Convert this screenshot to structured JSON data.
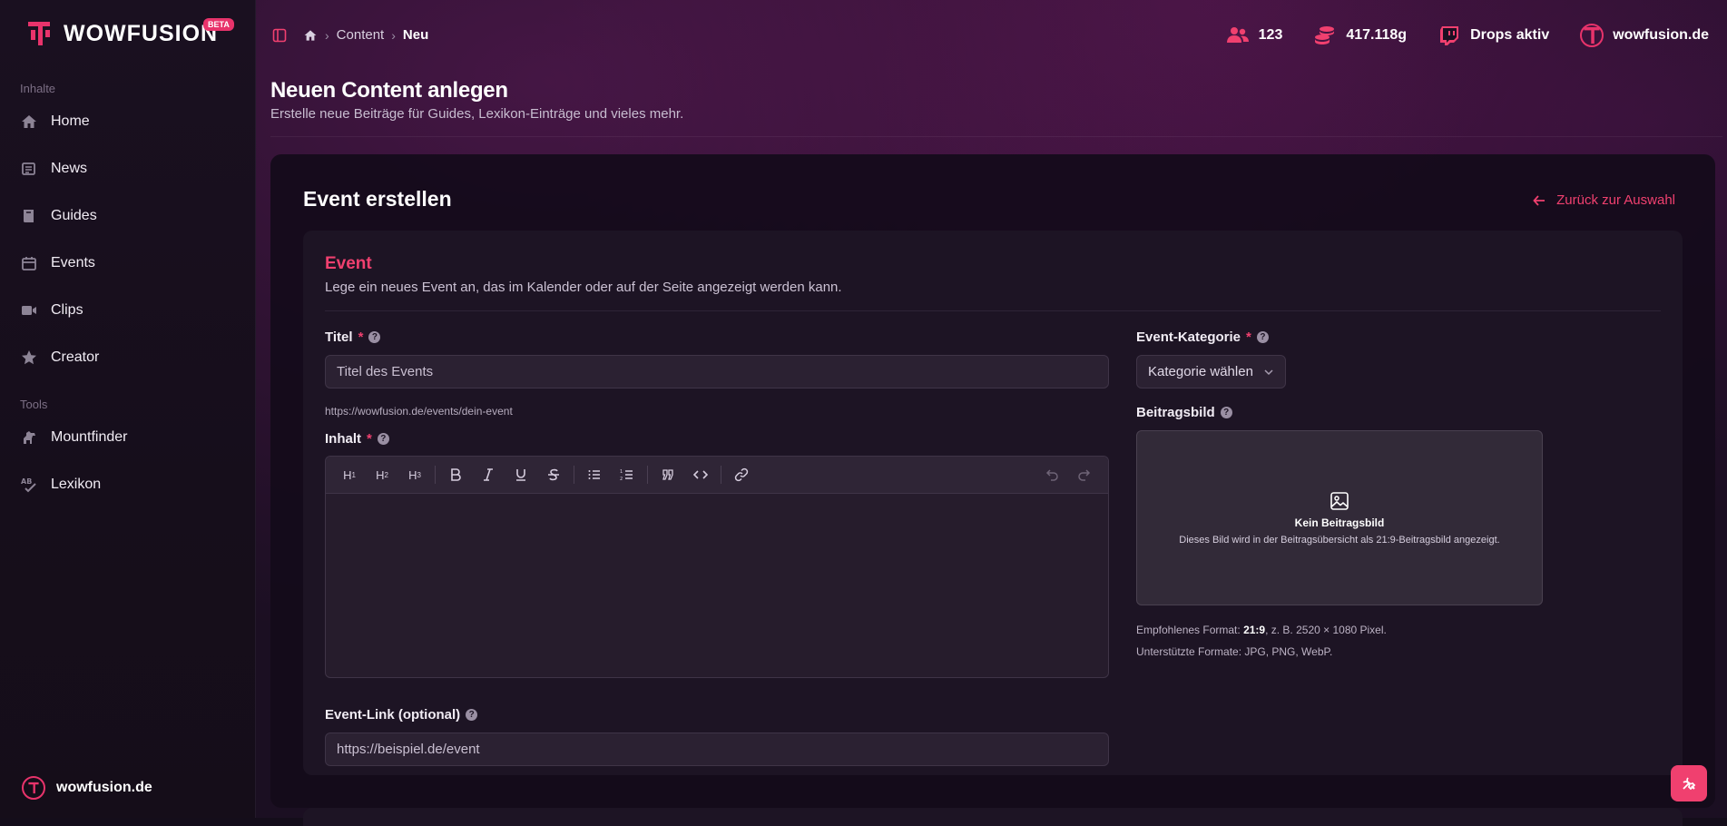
{
  "brand": {
    "name": "WOWFUSION",
    "badge": "BETA",
    "accent": "#e8336b"
  },
  "sidebar": {
    "sections": [
      {
        "label": "Inhalte",
        "items": [
          {
            "label": "Home",
            "icon": "home-icon"
          },
          {
            "label": "News",
            "icon": "newspaper-icon"
          },
          {
            "label": "Guides",
            "icon": "book-icon"
          },
          {
            "label": "Events",
            "icon": "calendar-icon"
          },
          {
            "label": "Clips",
            "icon": "video-icon"
          },
          {
            "label": "Creator",
            "icon": "star-icon"
          }
        ]
      },
      {
        "label": "Tools",
        "items": [
          {
            "label": "Mountfinder",
            "icon": "horse-icon"
          },
          {
            "label": "Lexikon",
            "icon": "abc-check-icon"
          }
        ]
      }
    ],
    "footer": {
      "label": "wowfusion.de"
    }
  },
  "topbar": {
    "breadcrumb": [
      "Content",
      "Neu"
    ],
    "stats": {
      "users": "123",
      "gold": "417.118g",
      "drops": "Drops aktiv",
      "site": "wowfusion.de"
    }
  },
  "header": {
    "title": "Neuen Content anlegen",
    "subtitle": "Erstelle neue Beiträge für Guides, Lexikon-Einträge und vieles mehr."
  },
  "panel": {
    "title": "Event erstellen",
    "back_label": "Zurück zur Auswahl"
  },
  "form": {
    "title": "Event",
    "description": "Lege ein neues Event an, das im Kalender oder auf der Seite angezeigt werden kann.",
    "title_field": {
      "label": "Titel",
      "placeholder": "Titel des Events",
      "slug": "https://wowfusion.de/events/dein-event"
    },
    "content_field": {
      "label": "Inhalt",
      "toolbar": [
        "H1",
        "H2",
        "H3",
        "bold",
        "italic",
        "underline",
        "strikethrough",
        "bullet-list",
        "ordered-list",
        "quote",
        "code",
        "link",
        "undo",
        "redo"
      ]
    },
    "link_field": {
      "label": "Event-Link (optional)",
      "placeholder": "https://beispiel.de/event"
    },
    "category_field": {
      "label": "Event-Kategorie",
      "selected": "Kategorie wählen"
    },
    "image_field": {
      "label": "Beitragsbild",
      "empty_title": "Kein Beitragsbild",
      "empty_desc": "Dieses Bild wird in der Beitragsübersicht als 21:9-Beitragsbild angezeigt.",
      "hint_prefix": "Empfohlenes Format: ",
      "hint_ratio": "21:9",
      "hint_suffix": ", z. B. 2520 × 1080 Pixel.",
      "formats": "Unterstützte Formate: JPG, PNG, WebP."
    }
  }
}
